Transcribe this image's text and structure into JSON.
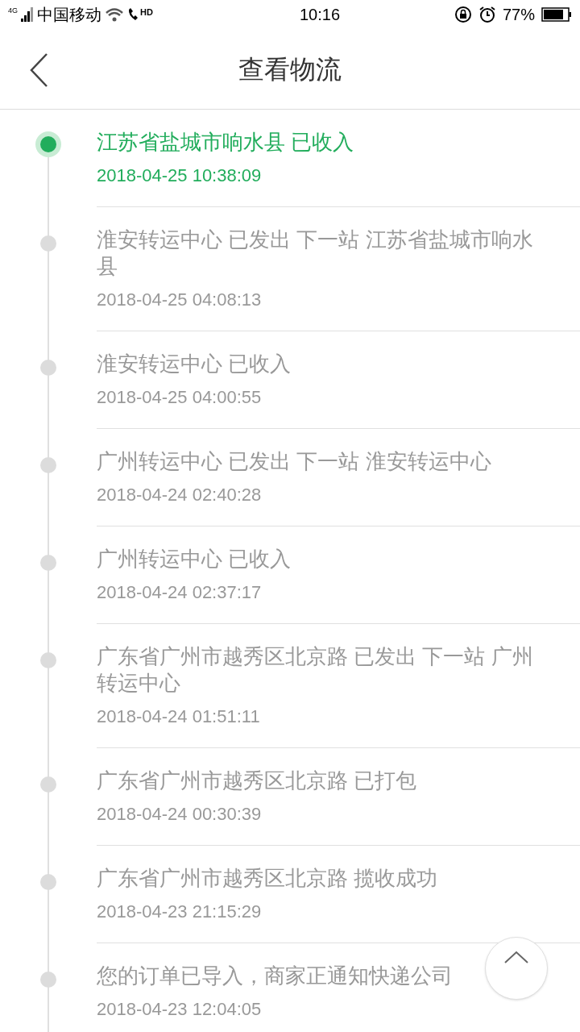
{
  "status_bar": {
    "network": "4G",
    "carrier": "中国移动",
    "hd": "HD",
    "time": "10:16",
    "battery": "77%"
  },
  "nav": {
    "title": "查看物流"
  },
  "events": [
    {
      "text": "江苏省盐城市响水县 已收入",
      "time": "2018-04-25 10:38:09",
      "selected": true
    },
    {
      "text": "淮安转运中心 已发出 下一站 江苏省盐城市响水县",
      "time": "2018-04-25 04:08:13",
      "selected": false
    },
    {
      "text": "淮安转运中心 已收入",
      "time": "2018-04-25 04:00:55",
      "selected": false
    },
    {
      "text": "广州转运中心 已发出 下一站 淮安转运中心",
      "time": "2018-04-24 02:40:28",
      "selected": false
    },
    {
      "text": "广州转运中心 已收入",
      "time": "2018-04-24 02:37:17",
      "selected": false
    },
    {
      "text": "广东省广州市越秀区北京路 已发出 下一站 广州转运中心",
      "time": "2018-04-24 01:51:11",
      "selected": false
    },
    {
      "text": "广东省广州市越秀区北京路 已打包",
      "time": "2018-04-24 00:30:39",
      "selected": false
    },
    {
      "text": "广东省广州市越秀区北京路 揽收成功",
      "time": "2018-04-23 21:15:29",
      "selected": false
    },
    {
      "text": "您的订单已导入，商家正通知快递公司",
      "time": "2018-04-23 12:04:05",
      "selected": false
    }
  ]
}
